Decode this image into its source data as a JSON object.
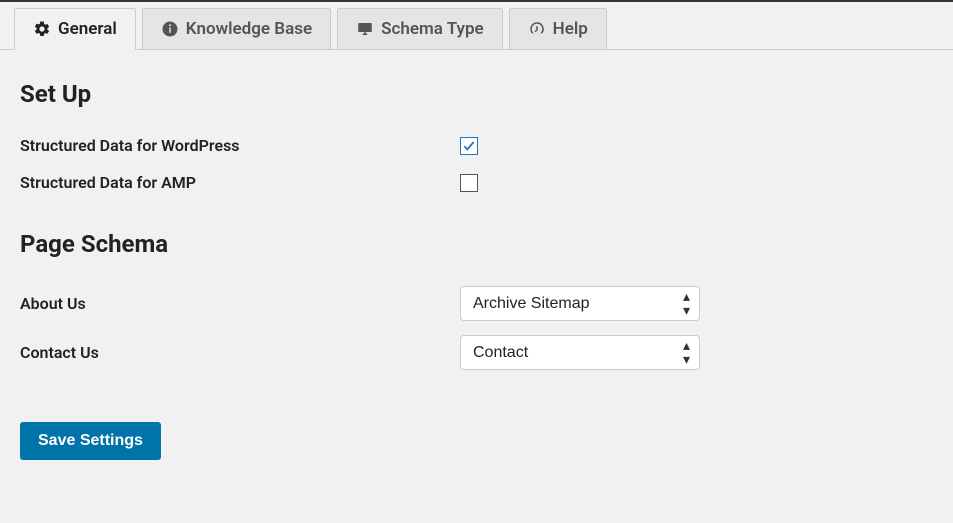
{
  "tabs": [
    {
      "label": "General",
      "icon": "gear-icon",
      "active": true
    },
    {
      "label": "Knowledge Base",
      "icon": "info-icon",
      "active": false
    },
    {
      "label": "Schema Type",
      "icon": "monitor-icon",
      "active": false
    },
    {
      "label": "Help",
      "icon": "dashboard-icon",
      "active": false
    }
  ],
  "sections": {
    "setup": {
      "heading": "Set Up",
      "rows": [
        {
          "label": "Structured Data for WordPress",
          "checked": true
        },
        {
          "label": "Structured Data for AMP",
          "checked": false
        }
      ]
    },
    "pageSchema": {
      "heading": "Page Schema",
      "rows": [
        {
          "label": "About Us",
          "value": "Archive Sitemap"
        },
        {
          "label": "Contact Us",
          "value": "Contact"
        }
      ]
    }
  },
  "buttons": {
    "save": "Save Settings"
  }
}
